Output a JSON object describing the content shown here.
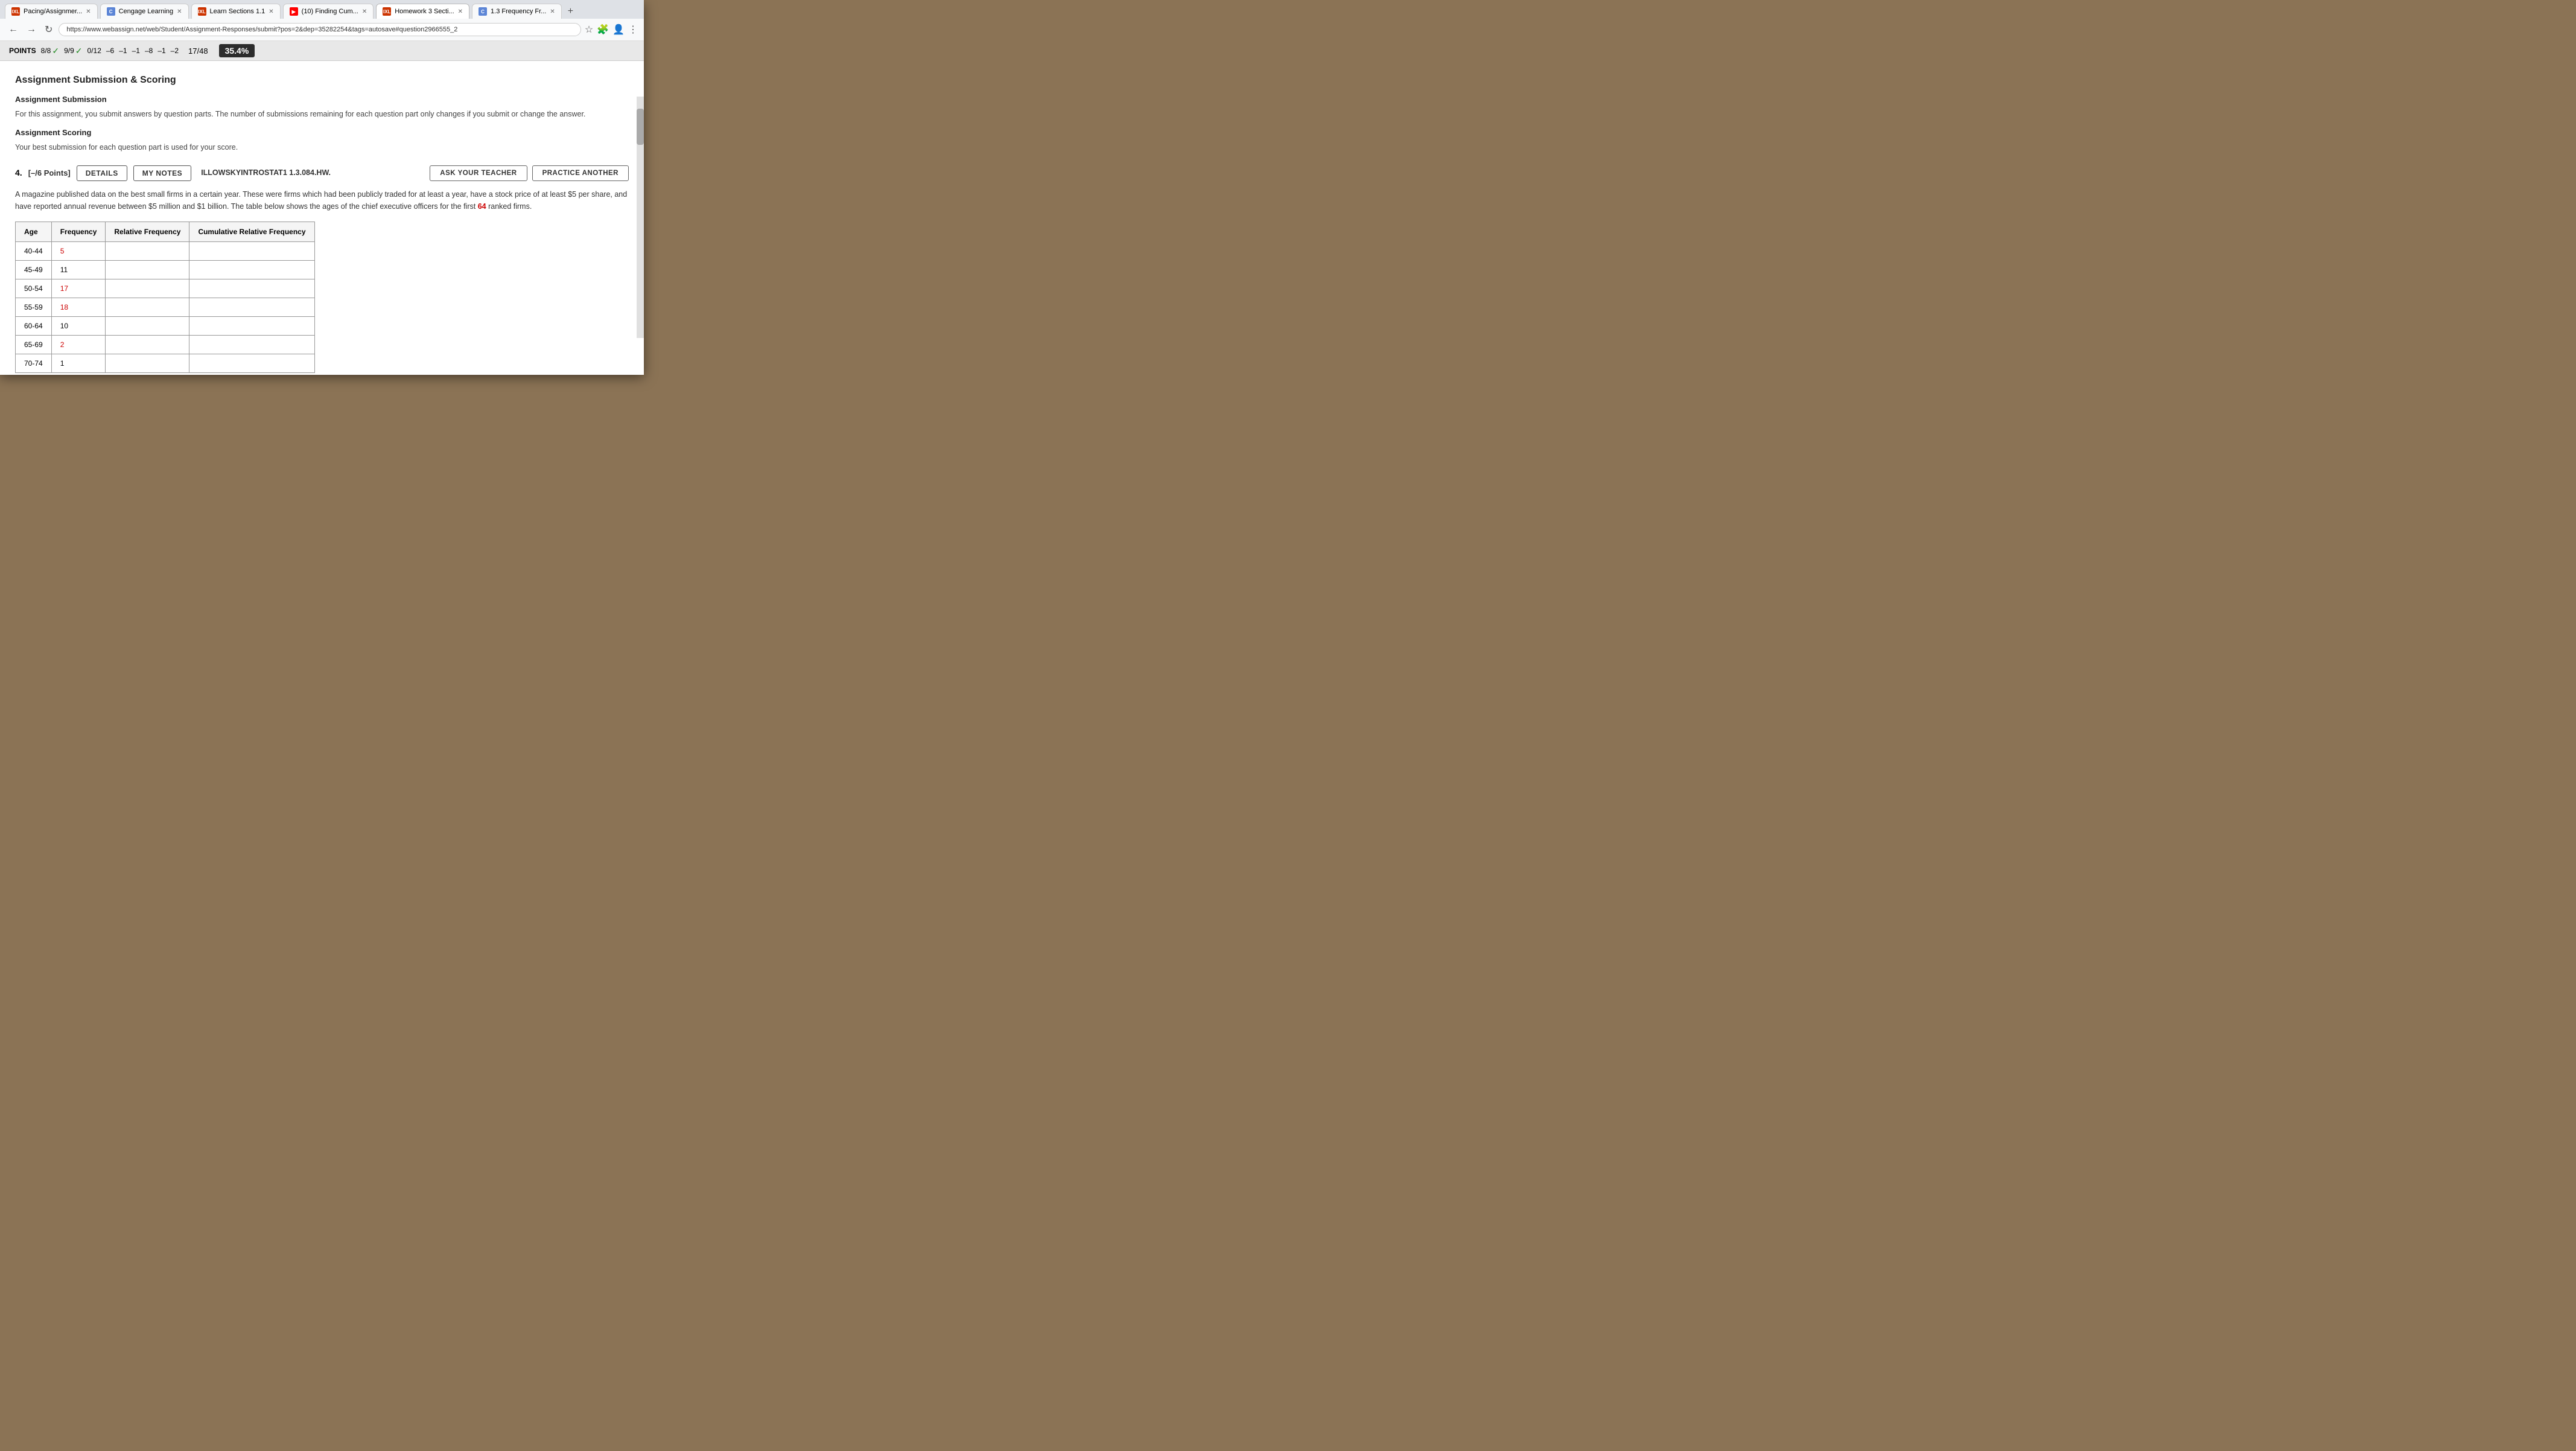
{
  "browser": {
    "tabs": [
      {
        "id": "tab1",
        "favicon_type": "hw",
        "favicon_label": "IXL",
        "label": "Pacing/Assignmer...",
        "active": false,
        "closeable": true
      },
      {
        "id": "tab2",
        "favicon_type": "cengage",
        "favicon_label": "C",
        "label": "Cengage Learning",
        "active": false,
        "closeable": true
      },
      {
        "id": "tab3",
        "favicon_type": "hw",
        "favicon_label": "IXL",
        "label": "Learn Sections 1.1",
        "active": false,
        "closeable": true
      },
      {
        "id": "tab4",
        "favicon_type": "yt",
        "favicon_label": "▶",
        "label": "(10) Finding Cum...",
        "active": false,
        "closeable": true
      },
      {
        "id": "tab5",
        "favicon_type": "hw",
        "favicon_label": "IXL",
        "label": "Homework 3 Secti...",
        "active": true,
        "closeable": true
      },
      {
        "id": "tab6",
        "favicon_type": "freq",
        "favicon_label": "C",
        "label": "1.3 Frequency Fr...",
        "active": false,
        "closeable": true
      }
    ],
    "url": "https://www.webassign.net/web/Student/Assignment-Responses/submit?pos=2&dep=35282254&tags=autosave#question2966555_2",
    "new_tab_label": "+"
  },
  "points_bar": {
    "label": "POINTS",
    "scores": [
      {
        "value": "8/8",
        "checked": true
      },
      {
        "value": "9/9",
        "checked": true
      },
      {
        "value": "0/12",
        "checked": false
      },
      {
        "value": "–6",
        "checked": false
      },
      {
        "value": "–1",
        "checked": false
      },
      {
        "value": "–1",
        "checked": false
      },
      {
        "value": "–8",
        "checked": false
      },
      {
        "value": "–1",
        "checked": false
      },
      {
        "value": "–2",
        "checked": false
      }
    ],
    "fraction": "17/48",
    "percentage": "35.4%"
  },
  "page": {
    "section_title": "Assignment Submission & Scoring",
    "submission_heading": "Assignment Submission",
    "submission_text": "For this assignment, you submit answers by question parts. The number of submissions remaining for each question part only changes if you submit or change the answer.",
    "scoring_heading": "Assignment Scoring",
    "scoring_text": "Your best submission for each question part is used for your score.",
    "question": {
      "number": "4.",
      "points_label": "[–/6 Points]",
      "details_btn": "DETAILS",
      "my_notes_btn": "MY NOTES",
      "problem_code": "ILLOWSKYINTROSTAT1 1.3.084.HW.",
      "ask_teacher_btn": "ASK YOUR TEACHER",
      "practice_btn": "PRACTICE ANOTHER",
      "description": "A magazine published data on the best small firms in a certain year. These were firms which had been publicly traded for at least a year, have a stock price of at least $5 per share, and have reported annual revenue between $5 million and $1 billion. The table below shows the ages of the chief executive officers for the first",
      "description_highlight": "64",
      "description_end": "ranked firms.",
      "table": {
        "headers": [
          "Age",
          "Frequency",
          "Relative Frequency",
          "Cumulative Relative Frequency"
        ],
        "rows": [
          {
            "age": "40-44",
            "frequency": "5",
            "freq_red": true,
            "rel_freq": "",
            "cum_rel_freq": ""
          },
          {
            "age": "45-49",
            "frequency": "11",
            "freq_red": false,
            "rel_freq": "",
            "cum_rel_freq": ""
          },
          {
            "age": "50-54",
            "frequency": "17",
            "freq_red": true,
            "rel_freq": "",
            "cum_rel_freq": ""
          },
          {
            "age": "55-59",
            "frequency": "18",
            "freq_red": true,
            "rel_freq": "",
            "cum_rel_freq": ""
          },
          {
            "age": "60-64",
            "frequency": "10",
            "freq_red": false,
            "rel_freq": "",
            "cum_rel_freq": ""
          },
          {
            "age": "65-69",
            "frequency": "2",
            "freq_red": true,
            "rel_freq": "",
            "cum_rel_freq": ""
          },
          {
            "age": "70-74",
            "frequency": "1",
            "freq_red": false,
            "rel_freq": "",
            "cum_rel_freq": ""
          }
        ]
      }
    }
  }
}
